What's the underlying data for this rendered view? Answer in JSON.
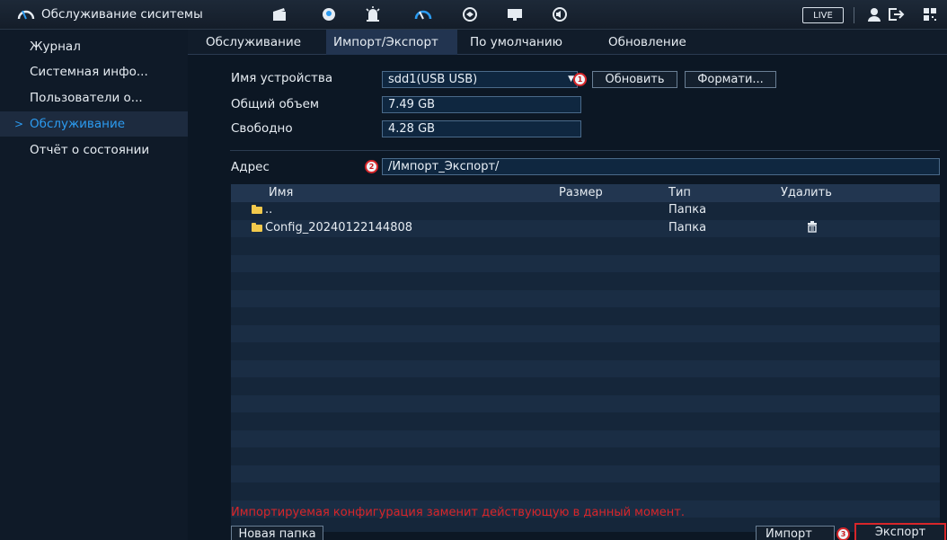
{
  "header": {
    "title": "Обслуживание сиситемы",
    "icons": [
      "gauge-icon",
      "clapper-icon",
      "face-icon",
      "alarm-icon",
      "gauge2-icon",
      "sync-icon",
      "monitor-icon",
      "speaker-icon"
    ],
    "live_label": "LIVE",
    "right_icons": [
      "user-icon",
      "logout-icon",
      "qr-icon"
    ]
  },
  "sidebar": {
    "items": [
      {
        "label": "Журнал"
      },
      {
        "label": "Системная инфо..."
      },
      {
        "label": "Пользователи о..."
      },
      {
        "label": "Обслуживание"
      },
      {
        "label": "Отчёт о состоянии"
      }
    ],
    "active_index": 3,
    "active_arrow": ">"
  },
  "tabs": [
    {
      "label": "Обслуживание"
    },
    {
      "label": "Импорт/Экспорт"
    },
    {
      "label": "По умолчанию"
    },
    {
      "label": "Обновление"
    }
  ],
  "device": {
    "name_label": "Имя устройства",
    "name_value": "sdd1(USB USB)",
    "refresh_label": "Обновить",
    "format_label": "Формати...",
    "total_label": "Общий объем",
    "total_value": "7.49 GB",
    "free_label": "Свободно",
    "free_value": "4.28 GB"
  },
  "address": {
    "label": "Адрес",
    "value": "/Импорт_Экспорт/"
  },
  "table": {
    "headers": {
      "name": "Имя",
      "size": "Размер",
      "type": "Тип",
      "delete": "Удалить"
    },
    "rows": [
      {
        "name": "..",
        "size": "",
        "type": "Папка",
        "deletable": false
      },
      {
        "name": "Config_20240122144808",
        "size": "",
        "type": "Папка",
        "deletable": true
      }
    ]
  },
  "badges": {
    "one": "1",
    "two": "2",
    "three": "3"
  },
  "warning": "Импортируемая конфигурация заменит действующую в данный момент.",
  "footer": {
    "new_folder_label": "Новая папка",
    "import_label": "Импорт",
    "export_label": "Экспорт"
  },
  "colors": {
    "accent": "#2c9bf0",
    "warning": "#d8262a",
    "highlight": "#d7262a"
  }
}
